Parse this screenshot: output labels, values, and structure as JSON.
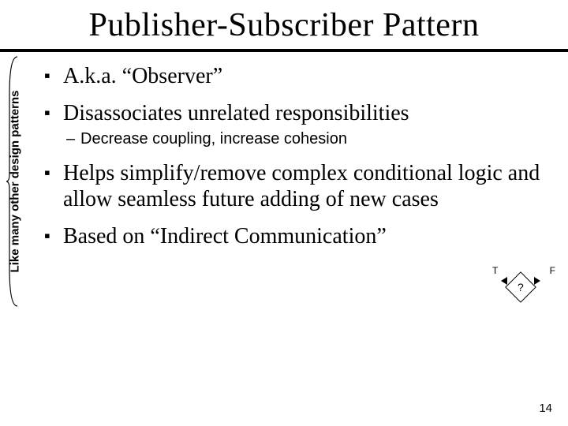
{
  "title": "Publisher-Subscriber Pattern",
  "side_label": "Like many other design patterns",
  "bullets": [
    {
      "text": "A.k.a. “Observer”"
    },
    {
      "text": "Disassociates unrelated responsibilities",
      "sub": [
        "Decrease coupling, increase cohesion"
      ]
    },
    {
      "text": "Helps simplify/remove complex conditional logic and allow seamless future adding of new cases"
    },
    {
      "text": "Based on “Indirect Communication”"
    }
  ],
  "decision": {
    "true_label": "T",
    "false_label": "F",
    "node_label": "?"
  },
  "page_number": "14"
}
